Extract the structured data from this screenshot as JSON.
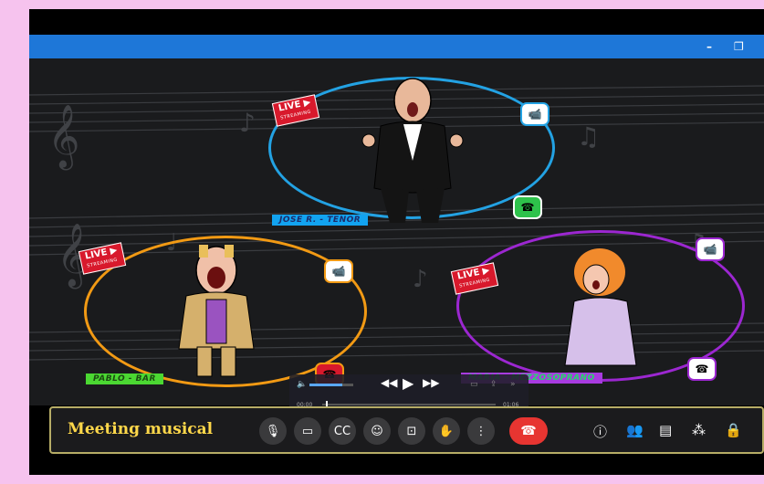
{
  "window": {
    "controls": {
      "minimize": "–",
      "restore": "❐",
      "close": "✕"
    }
  },
  "participants": [
    {
      "name": "JOSE R. - TENOR",
      "live_label": "LIVE ▶",
      "live_sub": "STREAMING",
      "ring_color": "#23a2e3"
    },
    {
      "name": "PABLO - BAR",
      "live_label": "LIVE ▶",
      "live_sub": "STREAMING",
      "ring_color": "#f29a14"
    },
    {
      "name": "MARIA - MEZZOSOPRANO",
      "live_label": "LIVE ▶",
      "live_sub": "STREAMING",
      "ring_color": "#9c27d1"
    }
  ],
  "player": {
    "time_current": "00:00",
    "time_total": "01:06",
    "volume_fraction": 0.75,
    "progress_fraction": 0.02
  },
  "toolbar": {
    "meeting_title": "Meeting musical",
    "buttons": [
      "mic-icon",
      "camera-icon",
      "captions-icon",
      "emoji-icon",
      "present-icon",
      "raise-hand-icon",
      "more-icon"
    ],
    "end_call_icon": "phone-hangup-icon",
    "right_icons": [
      "info-icon",
      "people-icon",
      "chat-icon",
      "activities-icon",
      "lock-icon"
    ]
  }
}
